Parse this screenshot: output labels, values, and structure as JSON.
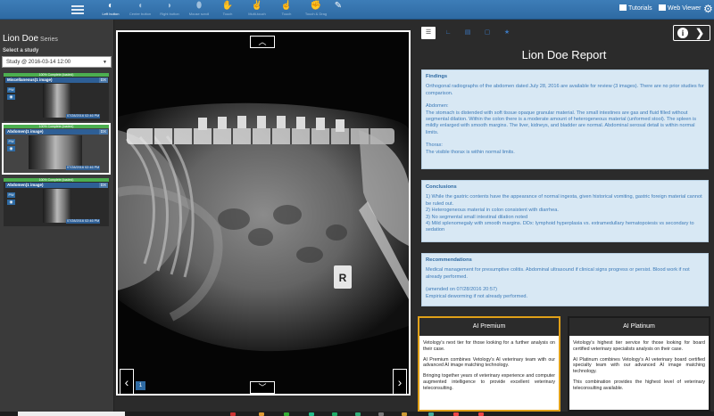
{
  "toolbar": {
    "tools": [
      {
        "label": "Left button",
        "icon": "pointer-icon",
        "active": true
      },
      {
        "label": "Center button",
        "icon": "mouse-icon",
        "active": false
      },
      {
        "label": "Right button",
        "icon": "mouse-right-icon",
        "active": false
      },
      {
        "label": "Mouse scroll",
        "icon": "scroll-icon",
        "active": false
      },
      {
        "label": "Touch",
        "icon": "hand-icon",
        "active": false
      },
      {
        "label": "Multi-touch",
        "icon": "multi-touch-icon",
        "active": false
      },
      {
        "label": "Touch",
        "icon": "touch-icon",
        "active": false
      },
      {
        "label": "Touch & Drag",
        "icon": "drag-icon",
        "active": false
      }
    ],
    "tutorials": "Tutorials",
    "web_viewer": "Web Viewer"
  },
  "left_panel": {
    "patient_name": "Lion Doe",
    "series_label": "Series",
    "select_label": "Select a study",
    "study_value": "Study @ 2016-03-14 12:00",
    "thumbnails": [
      {
        "progress": "100% Complete (loaded)",
        "name": "Miscellaneous(1 image)",
        "modality": "DX",
        "date": "07/28/2016 02:46 PM",
        "pw": "PW"
      },
      {
        "progress": "100% Complete (loaded)",
        "name": "Abdomen(1 image)",
        "modality": "DX",
        "date": "07/28/2016 02:46 PM",
        "pw": "PW"
      },
      {
        "progress": "100% Complete (loaded)",
        "name": "Abdomen(1 image)",
        "modality": "DX",
        "date": "07/28/2016 02:46 PM",
        "pw": "PW"
      }
    ]
  },
  "viewer": {
    "page_number": "1"
  },
  "report": {
    "title": "Lion Doe Report",
    "findings": {
      "heading": "Findings",
      "p1": "Orthogonal radiographs of the abdomen dated July 28, 2016 are available for review (3 images). There are no prior studies for comparison.",
      "p2": "Abdomen:",
      "p3": "The stomach is distended with soft tissue opaque granular material. The small intestines are gas and fluid filled without segmental dilation. Within the colon there is a moderate amount of heterogeneous material (unformed stool). The spleen is mildly enlarged with smooth margins. The liver, kidneys, and bladder are normal. Abdominal serosal detail is within normal limits.",
      "p4": "Thorax:",
      "p5": "The visible thorax is within normal limits."
    },
    "conclusions": {
      "heading": "Conclusions",
      "items": [
        "1) While the gastric contents have the appearance of normal ingesta, given historical vomiting, gastric foreign material cannot be ruled out.",
        "2) Heterogeneous material in colon consistent with diarrhea.",
        "3) No segmental small intestinal dilation noted",
        "4) Mild splenomegaly with smooth margins. DDx: lymphoid hyperplasia vs. extramedullary hematopoiesis vs secondary to sedation"
      ]
    },
    "recommendations": {
      "heading": "Recommendations",
      "p1": "Medical management for presumptive colitis. Abdominal ultrasound if clinical signs progress or persist. Blood work if not already performed.",
      "p2": "(amended on 07/28/2016 20:57)",
      "p3": "Empirical deworming if not already performed."
    },
    "premium": {
      "title": "AI Premium",
      "p1": "Vetology's next tier for those looking for a further analysis on their case.",
      "p2": "AI Premium combines Vetology's AI veterinary team with our advanced AI image matching technology.",
      "p3": "Bringing together years of veterinary experience and computer augmented intelligence to provide excellent veterinary teleconsulting."
    },
    "platinum": {
      "title": "AI Platinum",
      "p1": "Vetology's highest tier service for those looking for board certified veterinary specialists analysis on their case.",
      "p2": "AI Platinum combines Vetology's AI veterinary board certified specialty team with our advanced AI image matching technology.",
      "p3": "This combination provides the highest level of veterinary teleconsulting available."
    }
  },
  "colors": {
    "accent": "#2e6aa3",
    "section_bg": "#d8e8f4",
    "section_text": "#3c7ab8",
    "premium_border": "#e0a018"
  }
}
